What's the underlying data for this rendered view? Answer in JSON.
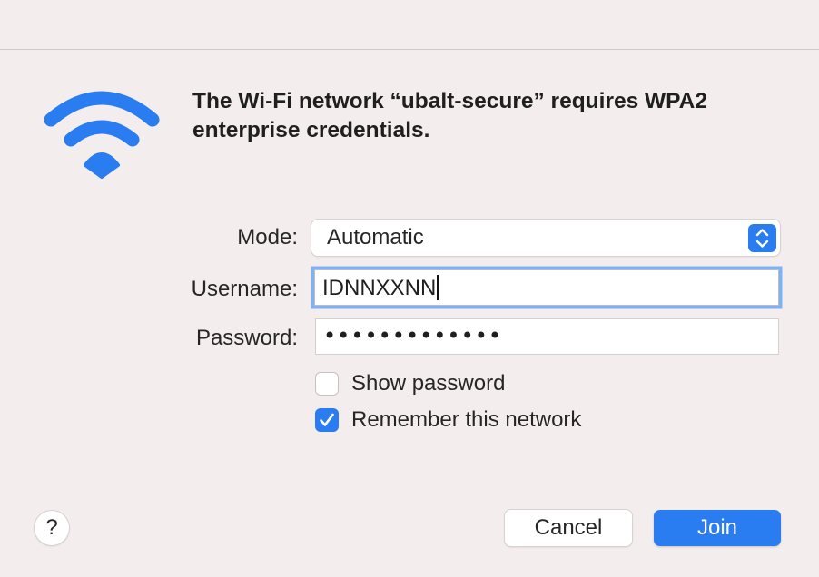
{
  "dialog": {
    "icon": "wifi-icon",
    "message": "The Wi-Fi network “ubalt-secure” requires WPA2 enterprise credentials.",
    "accent_color": "#2a7cf1"
  },
  "form": {
    "mode_label": "Mode:",
    "mode_value": "Automatic",
    "username_label": "Username:",
    "username_value": "IDNNXXNN",
    "password_label": "Password:",
    "password_value": "•••••••••••••",
    "show_password": {
      "label": "Show password",
      "checked": false
    },
    "remember_network": {
      "label": "Remember this network",
      "checked": true
    }
  },
  "buttons": {
    "help": "?",
    "cancel": "Cancel",
    "join": "Join"
  }
}
